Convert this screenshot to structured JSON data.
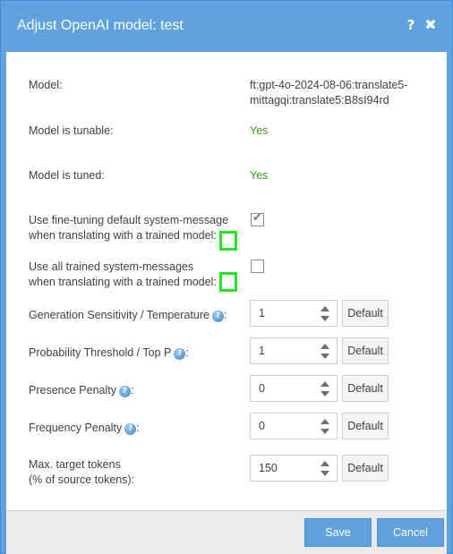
{
  "window": {
    "title": "Adjust OpenAI model: test",
    "help_icon": "?",
    "close_icon": "✖"
  },
  "fields": {
    "model": {
      "label": "Model:",
      "value_line1": "ft:gpt-4o-2024-08-06:translate5-",
      "value_line2": "mittagqi:translate5:B8sI94rd"
    },
    "tunable": {
      "label": "Model is tunable:",
      "value": "Yes"
    },
    "tuned": {
      "label": "Model is tuned:",
      "value": "Yes"
    },
    "use_default_msg": {
      "line1": "Use fine-tuning default system-message",
      "line2": "when translating with a trained model:",
      "checked": true
    },
    "use_all_msgs": {
      "line1": "Use all trained system-messages",
      "line2": "when translating with a trained model:",
      "checked": false
    },
    "temperature": {
      "label": "Generation Sensitivity / Temperature",
      "suffix": ":",
      "value": "1",
      "default_label": "Default"
    },
    "top_p": {
      "label": "Probability Threshold / Top P",
      "suffix": ":",
      "value": "1",
      "default_label": "Default"
    },
    "presence": {
      "label": "Presence Penalty",
      "suffix": ":",
      "value": "0",
      "default_label": "Default"
    },
    "frequency": {
      "label": "Frequency Penalty",
      "suffix": ":",
      "value": "0",
      "default_label": "Default"
    },
    "max_tokens": {
      "line1": "Max. target tokens",
      "line2": "(% of source tokens):",
      "value": "150",
      "default_label": "Default"
    }
  },
  "footer": {
    "save_label": "Save",
    "cancel_label": "Cancel"
  },
  "colors": {
    "accent": "#5fa2dd",
    "yes_green": "#3a9d23",
    "highlight_box": "#22e622"
  },
  "icons": {
    "help": "help-icon",
    "close": "close-icon",
    "checkmark": "checkmark-icon",
    "spin_up": "spinner-up-icon",
    "spin_down": "spinner-down-icon"
  }
}
